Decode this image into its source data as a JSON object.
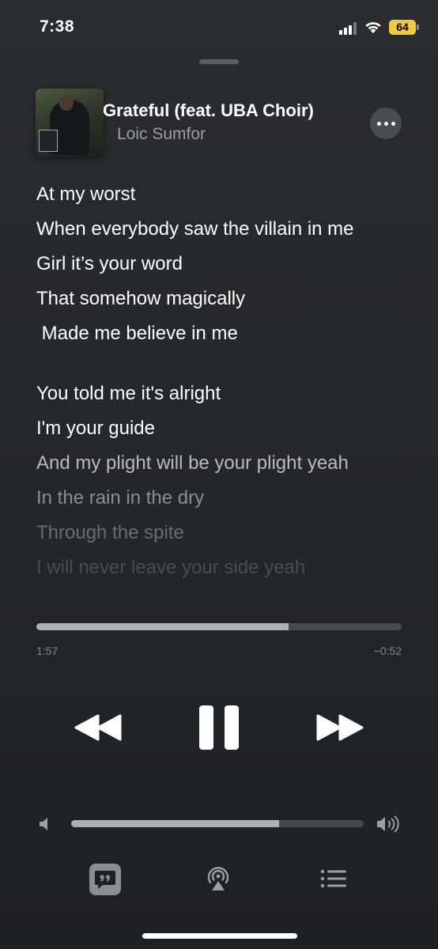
{
  "status_bar": {
    "time": "7:38",
    "battery": "64"
  },
  "now_playing": {
    "title": "Grateful (feat. UBA Choir)",
    "artist": "Loic Sumfor"
  },
  "lyrics": [
    {
      "text": "At my worst",
      "color": "#ffffff"
    },
    {
      "text": "When everybody saw the villain in me",
      "color": "#ffffff"
    },
    {
      "text": "Girl it’s your word",
      "color": "#ffffff"
    },
    {
      "text": "That somehow magically",
      "color": "#ffffff"
    },
    {
      "text": " Made me believe in me",
      "color": "#ffffff"
    },
    {
      "text": "",
      "color": "#ffffff"
    },
    {
      "text": "You told me it's alright",
      "color": "#ffffff"
    },
    {
      "text": "I'm your guide",
      "color": "#ffffff"
    },
    {
      "text": "And my plight will be your plight yeah",
      "color": "#b9babd"
    },
    {
      "text": "In the rain in the dry",
      "color": "#8c8d90"
    },
    {
      "text": "Through the spite",
      "color": "#6b6c6f"
    },
    {
      "text": "I will never leave your side yeah",
      "color": "#4a4b4e"
    }
  ],
  "playback": {
    "elapsed": "1:57",
    "remaining": "−0:52",
    "progress_fraction": 0.69
  },
  "volume": {
    "level_fraction": 0.71
  },
  "icons": {
    "signal": "cellular-signal-icon",
    "wifi": "wifi-icon",
    "rewind": "rewind-icon",
    "pause": "pause-icon",
    "forward": "fast-forward-icon",
    "volume_low": "speaker-low-icon",
    "volume_high": "speaker-high-icon",
    "lyrics": "lyrics-quote-icon",
    "airplay": "airplay-icon",
    "queue": "queue-list-icon",
    "more": "ellipsis-icon"
  },
  "colors": {
    "accent_battery": "#f2cc38",
    "background": "#262729",
    "secondary_text": "#9d9ea2"
  }
}
